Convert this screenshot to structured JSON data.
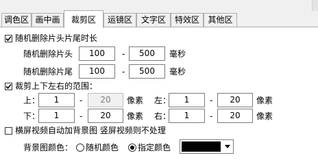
{
  "tabs": [
    {
      "label": "调色区"
    },
    {
      "label": "画中画"
    },
    {
      "label": "裁剪区"
    },
    {
      "label": "运镜区"
    },
    {
      "label": "文字区"
    },
    {
      "label": "特效区"
    },
    {
      "label": "其他区"
    }
  ],
  "active_tab": "裁剪区",
  "random_delete": {
    "checkbox_label": "随机删除片头片尾时长",
    "checked": true,
    "head": {
      "label": "随机删除片头",
      "min": "100",
      "max": "500",
      "unit": "毫秒"
    },
    "tail": {
      "label": "随机删除片尾",
      "min": "100",
      "max": "500",
      "unit": "毫秒"
    }
  },
  "crop": {
    "checkbox_label": "裁剪上下左右的范围：",
    "checked": true,
    "top": {
      "label": "上：",
      "min": "1",
      "max": "20",
      "unit": "像素"
    },
    "left": {
      "label": "左：",
      "min": "1",
      "max": "20",
      "unit": "像素"
    },
    "bottom": {
      "label": "下：",
      "min": "1",
      "max": "20",
      "unit": "像素"
    },
    "right": {
      "label": "右：",
      "min": "1",
      "max": "20",
      "unit": "像素"
    }
  },
  "range_separator": "-",
  "landscape": {
    "checkbox_label": "横屏视频自动加背景图 竖屏视频则不处理",
    "checked": false
  },
  "background_color": {
    "label": "背景图颜色：",
    "options": [
      "随机颜色",
      "指定颜色"
    ],
    "selected": "指定颜色",
    "color_value": "#000000"
  }
}
